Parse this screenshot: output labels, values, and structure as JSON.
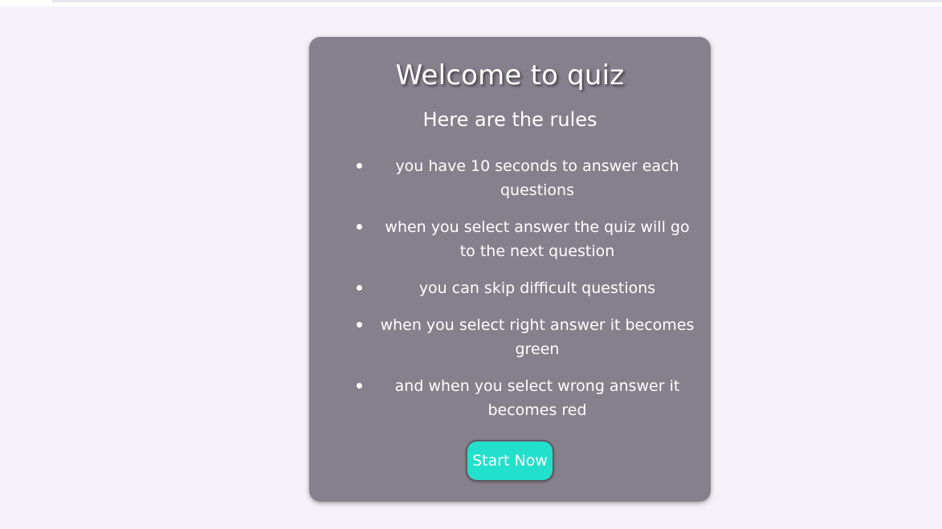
{
  "card": {
    "title": "Welcome to quiz",
    "subtitle": "Here are the rules",
    "rules": [
      "you have 10 seconds to answer each questions",
      "when you select answer the quiz will go to the next question",
      "you can skip difficult questions",
      "when you select right answer it becomes green",
      "and when you select wrong answer it becomes red"
    ],
    "start_button_label": "Start Now"
  },
  "colors": {
    "page_background": "#f4f1f8",
    "card_background": "#867f8c",
    "button_background": "#23e0cc",
    "text": "#ffffff"
  }
}
